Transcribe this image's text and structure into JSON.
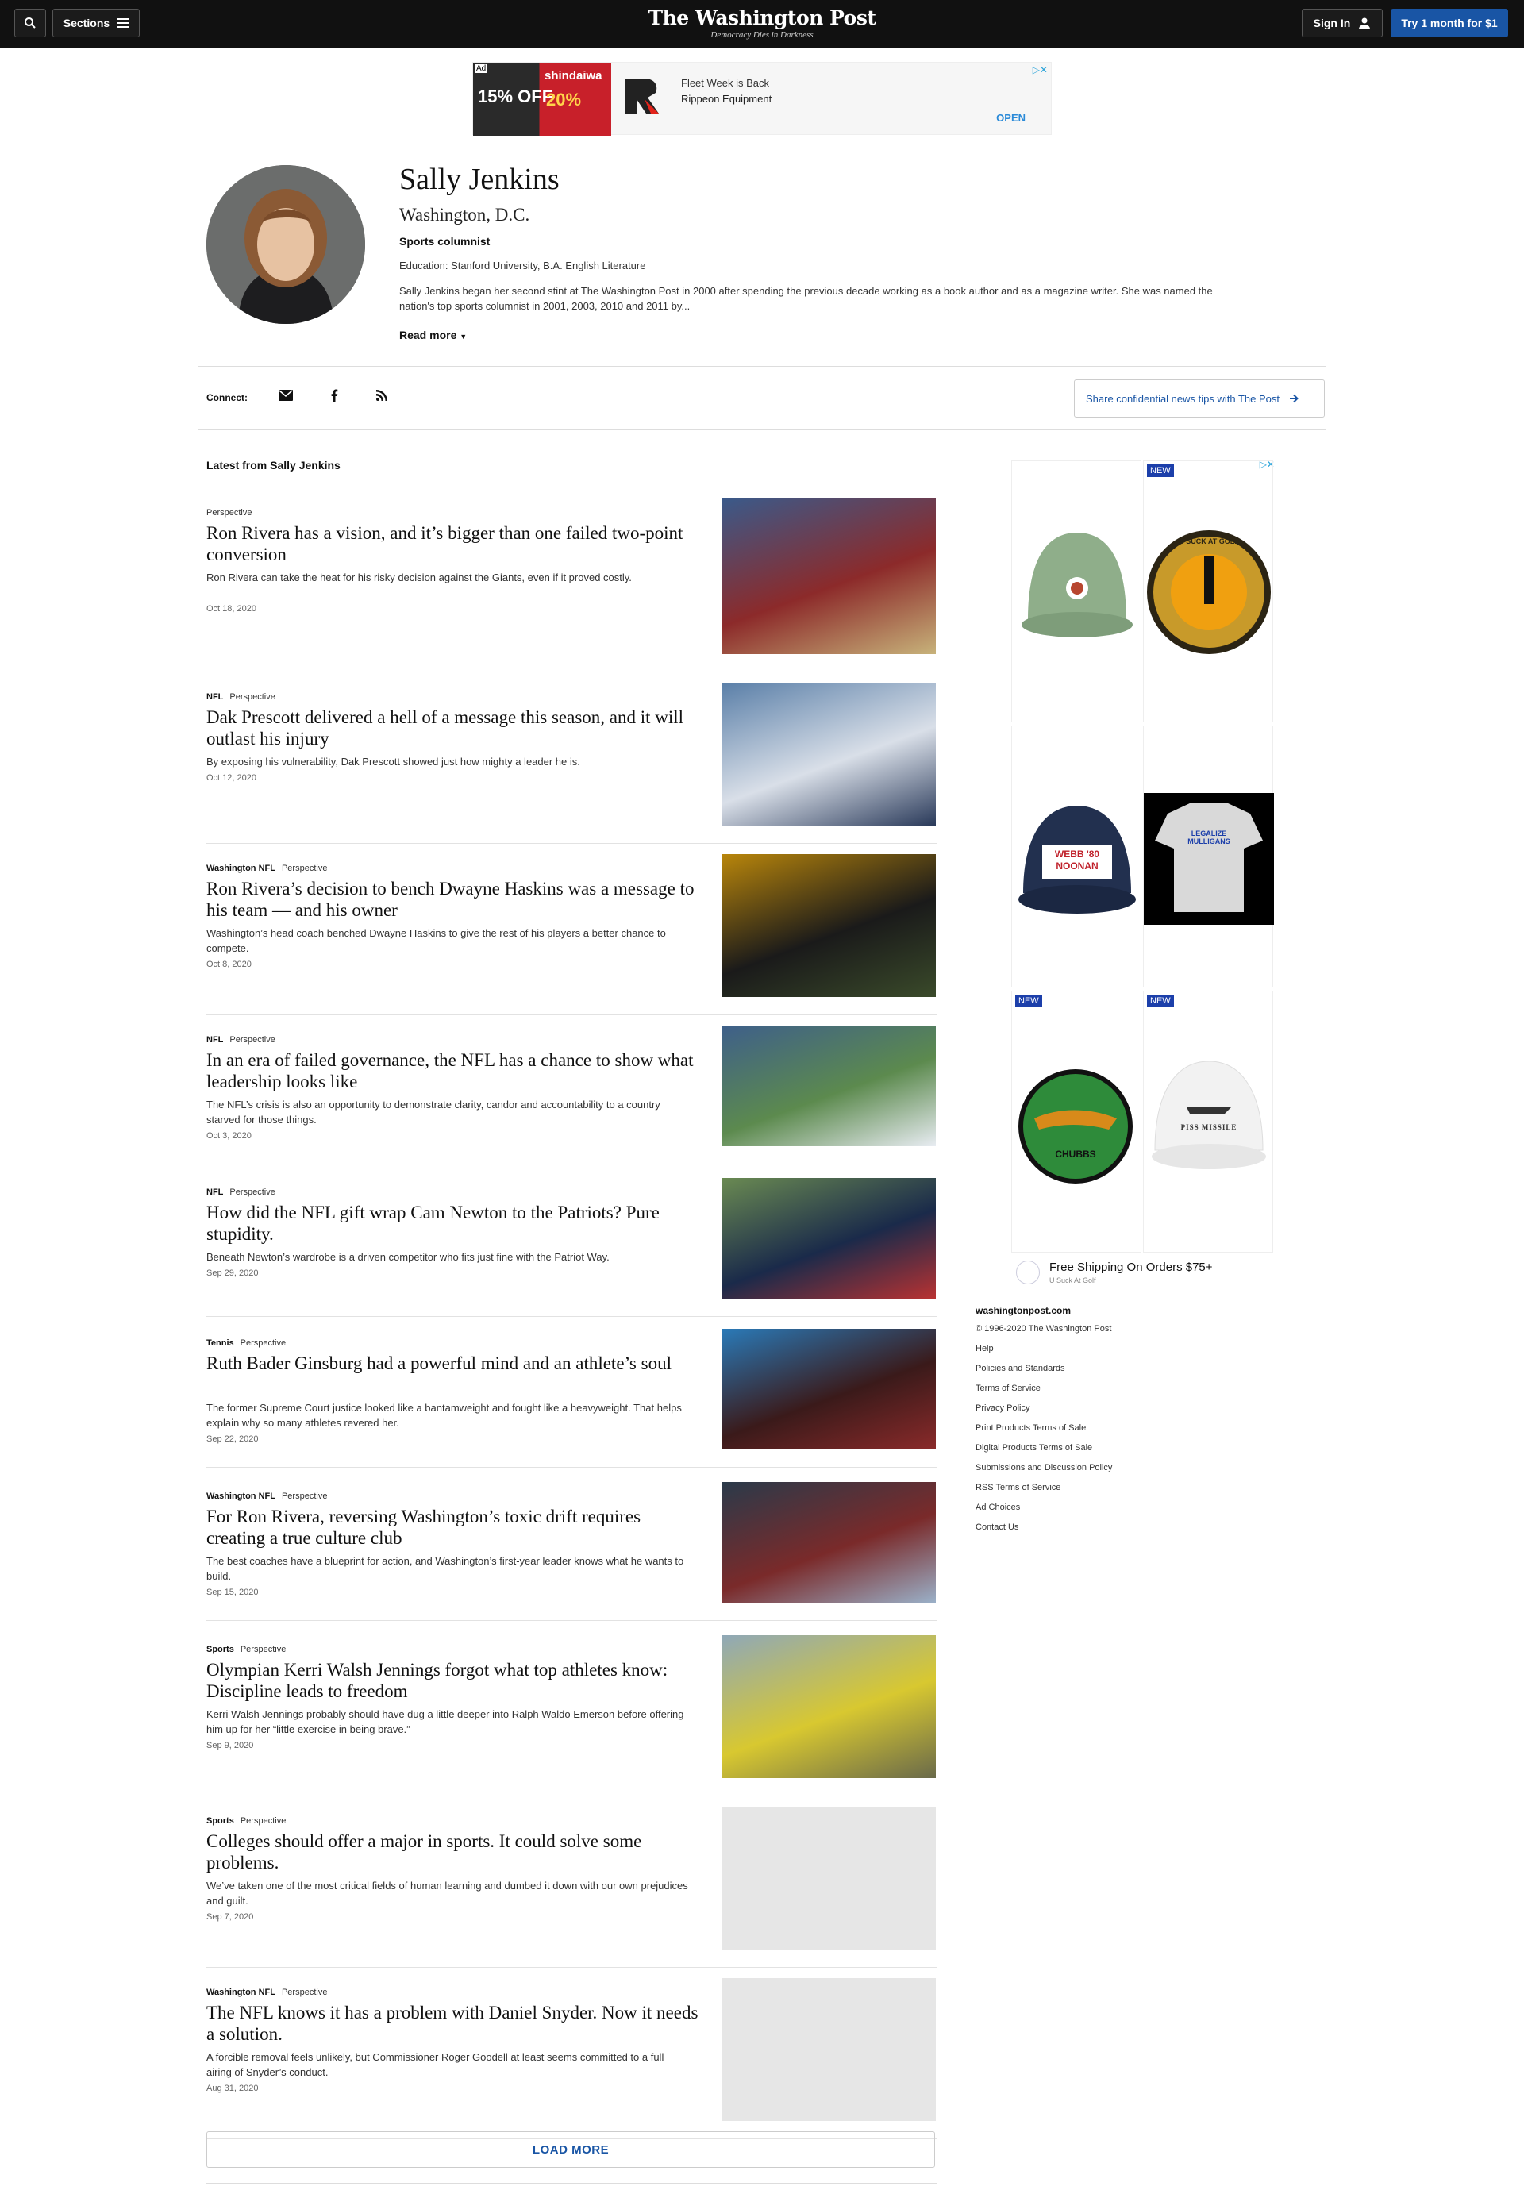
{
  "header": {
    "sections_label": "Sections",
    "logo": "The Washington Post",
    "tagline": "Democracy Dies in Darkness",
    "signin_label": "Sign In",
    "subscribe_label": "Try 1 month for $1"
  },
  "top_ad": {
    "badge": "Ad",
    "offer_left": "15% OFF",
    "brand": "shindaiwa",
    "offer_right": "20%",
    "line1": "Fleet Week is Back",
    "line2": "Rippeon Equipment",
    "cta": "OPEN"
  },
  "profile": {
    "name": "Sally Jenkins",
    "location": "Washington, D.C.",
    "role": "Sports columnist",
    "education": "Education: Stanford University, B.A. English Literature",
    "bio": "Sally Jenkins began her second stint at The Washington Post in 2000 after spending the previous decade working as a book author and as a magazine writer. She was named the nation's top sports columnist in 2001, 2003, 2010 and 2011 by...",
    "read_more": "Read more"
  },
  "connect": {
    "label": "Connect:",
    "tip_label": "Share confidential news tips with The Post"
  },
  "latest_title": "Latest from Sally Jenkins",
  "articles": [
    {
      "section": "",
      "type": "Perspective",
      "headline": "Ron Rivera has a vision, and it’s bigger than one failed two-point conversion",
      "blurb": "Ron Rivera can take the heat for his risky decision against the Giants, even if it proved costly.",
      "date": "Oct 18, 2020"
    },
    {
      "section": "NFL",
      "type": "Perspective",
      "headline": "Dak Prescott delivered a hell of a message this season, and it will outlast his injury",
      "blurb": "By exposing his vulnerability, Dak Prescott showed just how mighty a leader he is.",
      "date": "Oct 12, 2020"
    },
    {
      "section": "Washington NFL",
      "type": "Perspective",
      "headline": "Ron Rivera’s decision to bench Dwayne Haskins was a message to his team — and his owner",
      "blurb": "Washington’s head coach benched Dwayne Haskins to give the rest of his players a better chance to compete.",
      "date": "Oct 8, 2020"
    },
    {
      "section": "NFL",
      "type": "Perspective",
      "headline": "In an era of failed governance, the NFL has a chance to show what leadership looks like",
      "blurb": "The NFL’s crisis is also an opportunity to demonstrate clarity, candor and accountability to a country starved for those things.",
      "date": "Oct 3, 2020"
    },
    {
      "section": "NFL",
      "type": "Perspective",
      "headline": "How did the NFL gift wrap Cam Newton to the Patriots? Pure stupidity.",
      "blurb": "Beneath Newton’s wardrobe is a driven competitor who fits just fine with the Patriot Way.",
      "date": "Sep 29, 2020"
    },
    {
      "section": "Tennis",
      "type": "Perspective",
      "headline": "Ruth Bader Ginsburg had a powerful mind and an athlete’s soul",
      "blurb": "The former Supreme Court justice looked like a bantamweight and fought like a heavyweight. That helps explain why so many athletes revered her.",
      "date": "Sep 22, 2020"
    },
    {
      "section": "Washington NFL",
      "type": "Perspective",
      "headline": "For Ron Rivera, reversing Washington’s toxic drift requires creating a true culture club",
      "blurb": "The best coaches have a blueprint for action, and Washington’s first-year leader knows what he wants to build.",
      "date": "Sep 15, 2020"
    },
    {
      "section": "Sports",
      "type": "Perspective",
      "headline": "Olympian Kerri Walsh Jennings forgot what top athletes know: Discipline leads to freedom",
      "blurb": "Kerri Walsh Jennings probably should have dug a little deeper into Ralph Waldo Emerson before offering him up for her “little exercise in being brave.”",
      "date": "Sep 9, 2020"
    },
    {
      "section": "Sports",
      "type": "Perspective",
      "headline": "Colleges should offer a major in sports. It could solve some problems.",
      "blurb": "We’ve taken one of the most critical fields of human learning and dumbed it down with our own prejudices and guilt.",
      "date": "Sep 7, 2020"
    },
    {
      "section": "Washington NFL",
      "type": "Perspective",
      "headline": "The NFL knows it has a problem with Daniel Snyder. Now it needs a solution.",
      "blurb": "A forcible removal feels unlikely, but Commissioner Roger Goodell at least seems committed to a full airing of Snyder’s conduct.",
      "date": "Aug 31, 2020"
    }
  ],
  "load_more": "LOAD MORE",
  "side_ad": {
    "new_badge": "NEW",
    "product_text_1": "U SUCK AT GOLF",
    "product_text_2": "WEBB '80 NOONAN",
    "product_text_3": "LEGALIZE MULLIGANS",
    "product_text_4": "CHUBBS",
    "product_text_5": "PISS MISSILE",
    "shipping": "Free Shipping On Orders $75+",
    "advertiser": "U Suck At Golf"
  },
  "footer": {
    "site": "washingtonpost.com",
    "links": [
      "© 1996-2020 The Washington Post",
      "Help",
      "Policies and Standards",
      "Terms of Service",
      "Privacy Policy",
      "Print Products Terms of Sale",
      "Digital Products Terms of Sale",
      "Submissions and Discussion Policy",
      "RSS Terms of Service",
      "Ad Choices",
      "Contact Us"
    ]
  },
  "colors": {
    "accent": "#1955a5",
    "topbar": "#111111"
  }
}
